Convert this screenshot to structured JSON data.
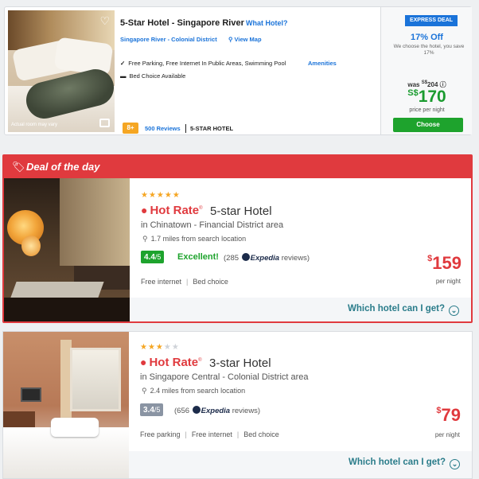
{
  "express_card": {
    "title": "5-Star Hotel - Singapore River",
    "what_hotel_link": "What Hotel?",
    "area": "Singapore River - Colonial District",
    "view_map": "View Map",
    "amenities_text": "Free Parking, Free Internet In Public Areas, Swimming Pool",
    "amenities_link": "Amenities",
    "bed_text": "Bed Choice Available",
    "photo_caption": "Actual room may vary",
    "score": "8+",
    "reviews": "500 Reviews",
    "hotel_class": "5-STAR HOTEL",
    "badge": "EXPRESS DEAL",
    "discount": "17% Off",
    "choose_note": "We choose the hotel, you save 17%",
    "was_label": "was",
    "was_currency": "S$",
    "was_price": "204",
    "currency": "S$",
    "price": "170",
    "per_night": "price per night",
    "choose_button": "Choose"
  },
  "deal_of_day": {
    "header": "Deal of the day",
    "stars_on": 5,
    "stars_total": 5,
    "brand": "Hot Rate",
    "trademark": "®",
    "hotel_class": "5-star Hotel",
    "area": "in Chinatown - Financial District area",
    "distance": "1.7 miles from search location",
    "score": "4.4",
    "score_denom": "/5",
    "score_word": "Excellent!",
    "review_count": "(285",
    "review_source": "Expedia",
    "review_suffix": "reviews)",
    "features": [
      "Free internet",
      "Bed choice"
    ],
    "currency": "$",
    "price": "159",
    "per_night": "per night",
    "which_hotel": "Which hotel can I get?",
    "colors": {
      "accent": "#e03a3e",
      "score_bg": "#1ea32d"
    }
  },
  "hotel_3star": {
    "stars_on": 3,
    "stars_total": 5,
    "brand": "Hot Rate",
    "trademark": "®",
    "hotel_class": "3-star Hotel",
    "area": "in Singapore Central - Colonial District area",
    "distance": "2.4 miles from search location",
    "score": "3.4",
    "score_denom": "/5",
    "review_count": "(656",
    "review_source": "Expedia",
    "review_suffix": "reviews)",
    "features": [
      "Free parking",
      "Free internet",
      "Bed choice"
    ],
    "currency": "$",
    "price": "79",
    "per_night": "per night",
    "which_hotel": "Which hotel can I get?",
    "colors": {
      "score_bg": "#8a94a3"
    }
  }
}
